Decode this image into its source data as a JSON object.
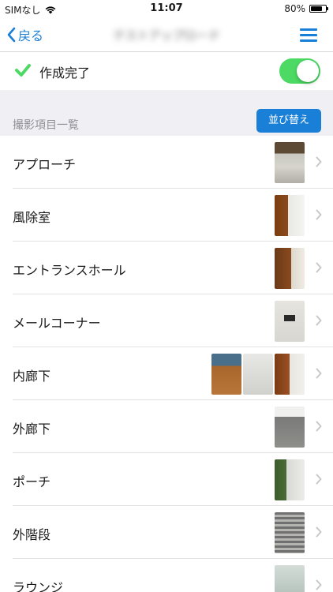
{
  "status_bar": {
    "carrier": "SIMなし",
    "time": "11:07",
    "battery": "80%",
    "battery_level": 0.8
  },
  "nav": {
    "back_label": "戻る",
    "title": "テストアップロード"
  },
  "completion": {
    "label": "作成完了",
    "toggle_on": true
  },
  "section": {
    "title": "撮影項目一覧",
    "sort_label": "並び替え"
  },
  "items": [
    {
      "label": "アプローチ"
    },
    {
      "label": "風除室"
    },
    {
      "label": "エントランスホール"
    },
    {
      "label": "メールコーナー"
    },
    {
      "label": "内廊下"
    },
    {
      "label": "外廊下"
    },
    {
      "label": "ポーチ"
    },
    {
      "label": "外階段"
    },
    {
      "label": "ラウンジ"
    }
  ],
  "colors": {
    "accent": "#1a7fd6",
    "toggle_on": "#4cd964",
    "check": "#4cd964",
    "section_bg": "#efeff4"
  }
}
